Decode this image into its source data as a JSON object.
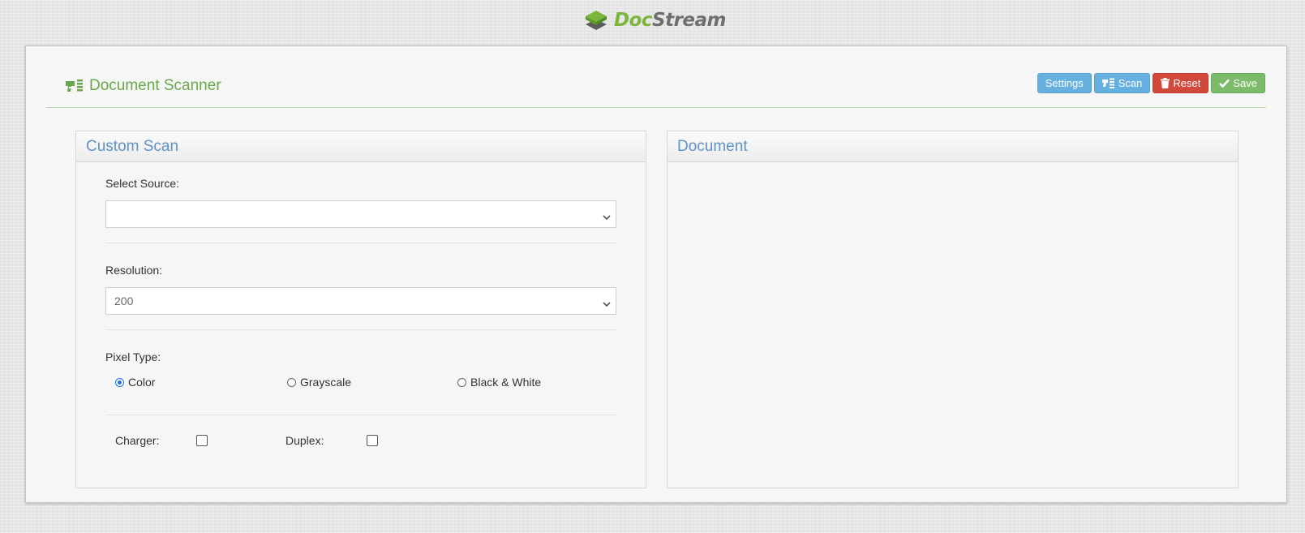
{
  "logo": {
    "part1": "Doc",
    "part2": "Stream",
    "icon": "stacked-layers-icon",
    "colors": {
      "doc": "#7bb53b",
      "stream": "#6f6f6f"
    }
  },
  "header": {
    "title": "Document Scanner",
    "title_icon": "scanner-icon",
    "title_color": "#69a84a"
  },
  "toolbar": {
    "settings_label": "Settings",
    "scan_label": "Scan",
    "reset_label": "Reset",
    "save_label": "Save",
    "colors": {
      "settings": "#65b0de",
      "scan": "#65b0de",
      "reset": "#d2483a",
      "save": "#7cbb6a"
    }
  },
  "custom_scan": {
    "title": "Custom Scan",
    "source_label": "Select Source:",
    "source_value": "",
    "resolution_label": "Resolution:",
    "resolution_value": "200",
    "pixel_type_label": "Pixel Type:",
    "pixel_types": [
      {
        "label": "Color",
        "checked": true
      },
      {
        "label": "Grayscale",
        "checked": false
      },
      {
        "label": "Black & White",
        "checked": false
      }
    ],
    "charger_label": "Charger:",
    "charger_checked": false,
    "duplex_label": "Duplex:",
    "duplex_checked": false
  },
  "document": {
    "title": "Document"
  }
}
